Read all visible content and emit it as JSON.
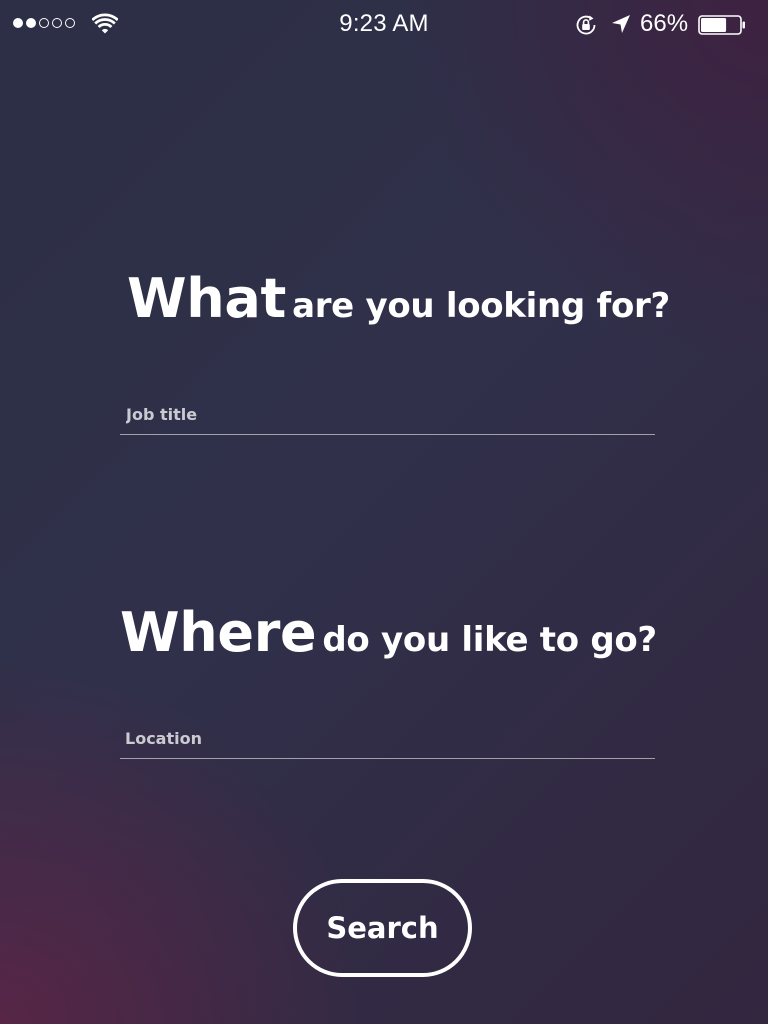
{
  "status_bar": {
    "signal": {
      "filled": 2,
      "total": 5
    },
    "time": "9:23 AM",
    "battery_percent_label": "66%",
    "battery_level": 0.66,
    "icons": [
      "signal-dots",
      "wifi-icon",
      "rotation-lock-icon",
      "location-arrow-icon",
      "battery-icon"
    ]
  },
  "what_section": {
    "title_big": "What",
    "title_small": "are you looking for?",
    "input": {
      "placeholder": "Job title",
      "value": ""
    }
  },
  "where_section": {
    "title_big": "Where",
    "title_small": "do you like to go?",
    "input": {
      "placeholder": "Location",
      "value": ""
    }
  },
  "search_button": {
    "label": "Search"
  },
  "colors": {
    "background_base": "#2f3047",
    "background_accent_left": "#5a2040",
    "background_accent_right": "#3a2040",
    "text": "#ffffff"
  }
}
